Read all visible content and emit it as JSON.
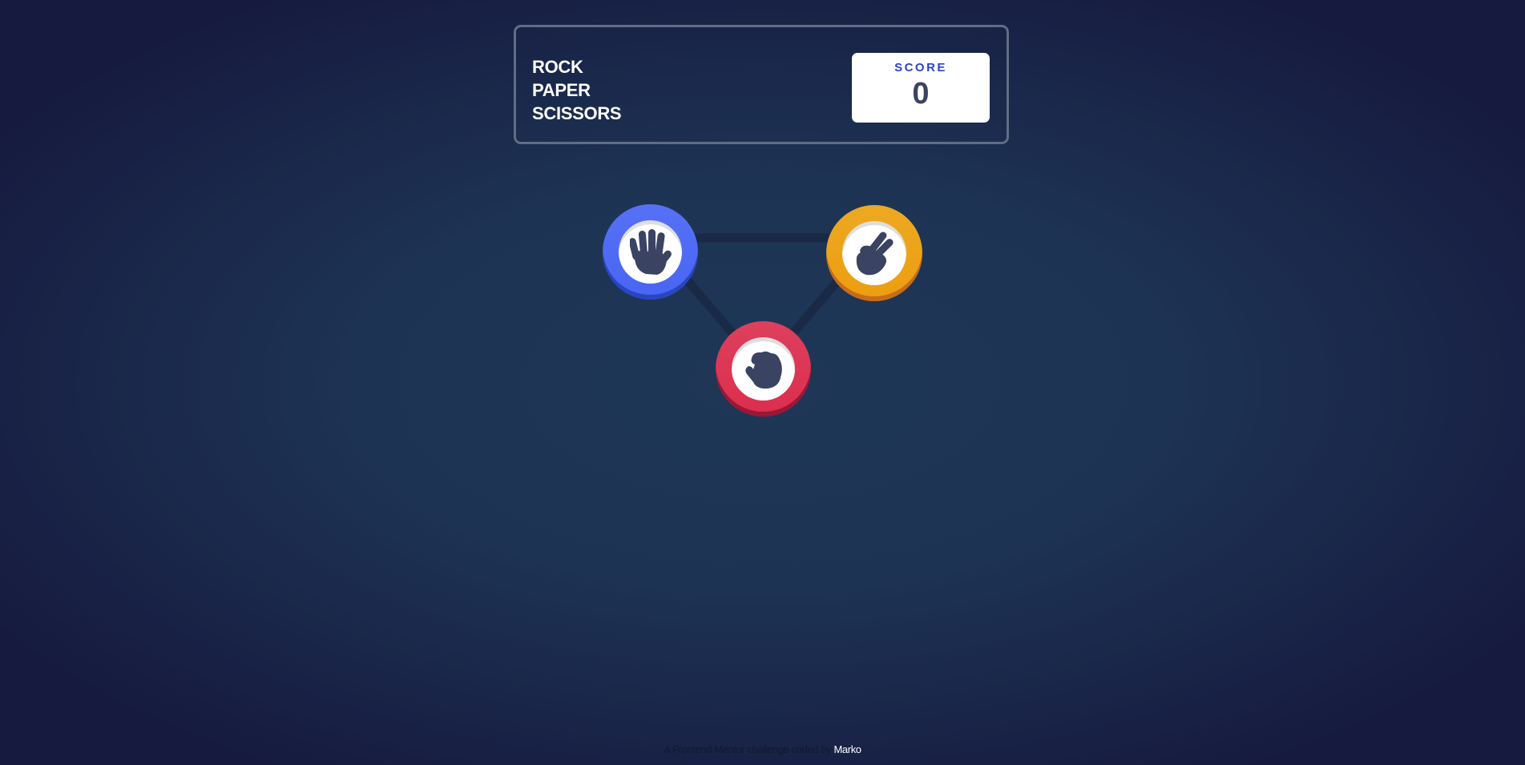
{
  "header": {
    "title_lines": [
      "ROCK",
      "PAPER",
      "SCISSORS"
    ],
    "score_label": "SCORE",
    "score_value": "0"
  },
  "choices": [
    {
      "name": "paper",
      "icon": "paper-hand-icon",
      "color": "#4865f4"
    },
    {
      "name": "scissors",
      "icon": "scissors-hand-icon",
      "color": "#ec9e0e"
    },
    {
      "name": "rock",
      "icon": "rock-fist-icon",
      "color": "#db2e4d"
    }
  ],
  "footer": {
    "text": "A Frontend Mentor challenge coded by",
    "author": "Marko"
  },
  "colors": {
    "background_center": "#1f3756",
    "background_edge": "#161a3f",
    "header_border": "#5f6e85",
    "score_label": "#2a46c0",
    "score_value": "#3b4363",
    "icon": "#3b4363"
  }
}
